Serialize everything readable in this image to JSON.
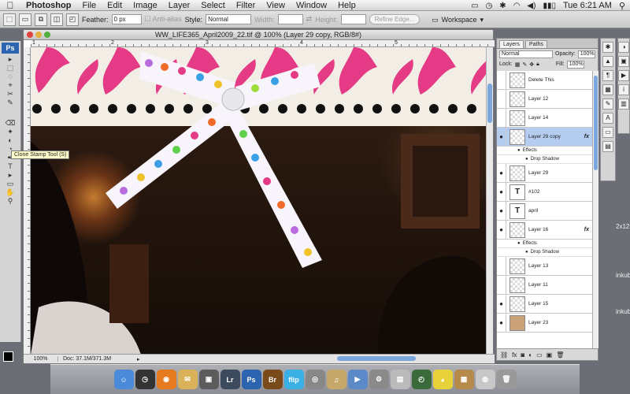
{
  "menubar": {
    "apple": "",
    "app_name": "Photoshop",
    "menus": [
      "File",
      "Edit",
      "Image",
      "Layer",
      "Select",
      "Filter",
      "View",
      "Window",
      "Help"
    ],
    "clock": "Tue 6:21 AM"
  },
  "options": {
    "feather_label": "Feather:",
    "feather_value": "0 px",
    "antialias_label": "Anti-alias",
    "style_label": "Style:",
    "style_value": "Normal",
    "width_label": "Width:",
    "height_label": "Height:",
    "refine_edge": "Refine Edge...",
    "workspace": "Workspace"
  },
  "tools": {
    "logo": "Ps",
    "tooltip": "Clone Stamp Tool (S)",
    "glyphs": [
      "▸",
      "⬚",
      "◌",
      "⌖",
      "✂",
      "✎",
      "⌫",
      "✦",
      "◐",
      "◔",
      "✒",
      "T",
      "▸",
      "▭",
      "✋",
      "⚲"
    ]
  },
  "document": {
    "title": "WW_LIFE365_April2009_22.tif @ 100% (Layer 29 copy, RGB/8#)",
    "ruler_marks": [
      "1",
      "2",
      "3",
      "4",
      "5"
    ],
    "zoom": "100%",
    "doc_info": "Doc: 37.1M/371.3M"
  },
  "layers_panel": {
    "tabs": [
      "Layers",
      "Paths"
    ],
    "blend_mode": "Normal",
    "opacity_label": "Opacity:",
    "opacity_value": "100%",
    "lock_label": "Lock:",
    "fill_label": "Fill:",
    "fill_value": "100%",
    "layers": [
      {
        "name": "Delete This",
        "visible": false,
        "type": "pixel"
      },
      {
        "name": "Layer 12",
        "visible": false,
        "type": "pixel"
      },
      {
        "name": "Layer 14",
        "visible": false,
        "type": "pixel"
      },
      {
        "name": "Layer 29 copy",
        "visible": true,
        "type": "pixel",
        "selected": true,
        "fx": true
      },
      {
        "name": "Layer 29",
        "visible": true,
        "type": "pixel"
      },
      {
        "name": "#102",
        "visible": true,
        "type": "text"
      },
      {
        "name": "april",
        "visible": true,
        "type": "text"
      },
      {
        "name": "Layer 16",
        "visible": true,
        "type": "pixel",
        "fx": true
      },
      {
        "name": "Layer 13",
        "visible": false,
        "type": "pixel"
      },
      {
        "name": "Layer 11",
        "visible": false,
        "type": "pixel"
      },
      {
        "name": "Layer 15",
        "visible": true,
        "type": "pixel"
      },
      {
        "name": "Layer 23",
        "visible": true,
        "type": "pixel"
      }
    ],
    "effects_label": "Effects",
    "drop_shadow_label": "Drop Shadow",
    "fx_label": "fx"
  },
  "desktop_text": [
    "2x12",
    "inkubo",
    "inkubo"
  ],
  "dock_apps": [
    "Finder",
    "Dashboard",
    "Firefox",
    "Mail",
    "iPhoto",
    "Lr",
    "Ps",
    "Br",
    "Flip",
    "DVD",
    "iTunes",
    "iMovie",
    "Pref",
    "Preview",
    "Time",
    "Duck",
    "Sys",
    "Cam",
    "Trash"
  ],
  "colors": {
    "accent": "#7ca7dc",
    "ps_blue": "#2c64b0",
    "ribbon_pink": "#e53a85",
    "selection": "#b5cdf0"
  }
}
